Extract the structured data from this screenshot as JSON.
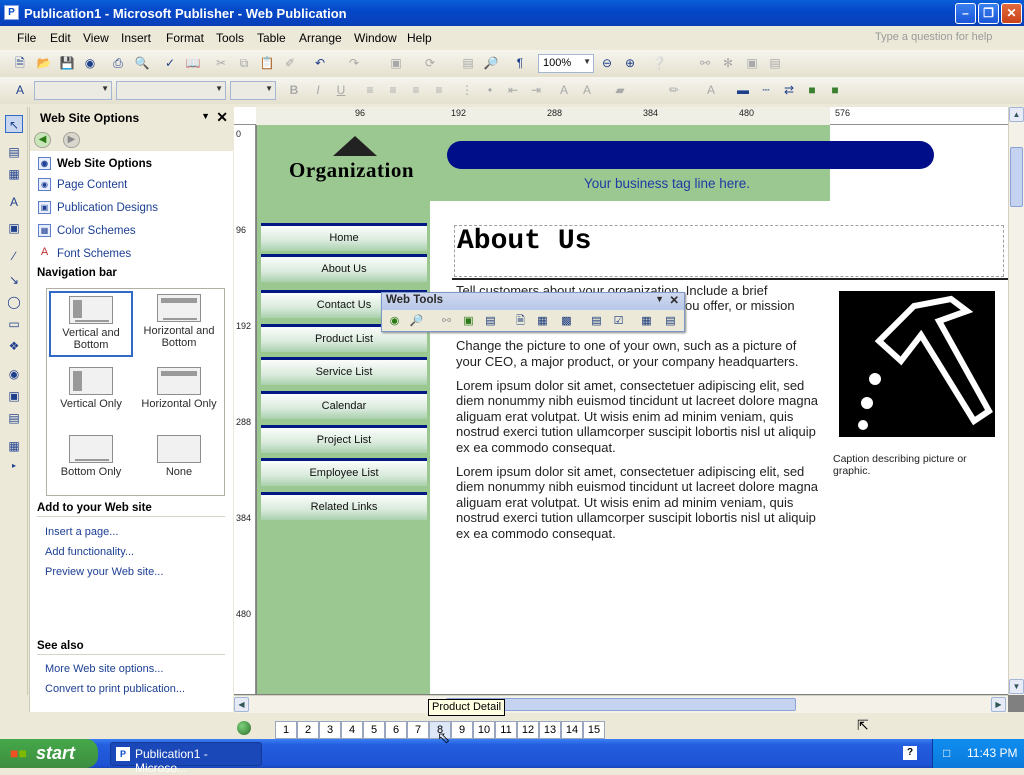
{
  "window": {
    "title": "Publication1 - Microsoft Publisher - Web Publication",
    "icon": "publisher-icon"
  },
  "menubar": {
    "items": [
      "File",
      "Edit",
      "View",
      "Insert",
      "Format",
      "Tools",
      "Table",
      "Arrange",
      "Window",
      "Help"
    ],
    "ask_placeholder": "Type a question for help"
  },
  "toolbar": {
    "zoom": "100%"
  },
  "taskpane": {
    "title": "Web Site Options",
    "items": [
      "Web Site Options",
      "Page Content",
      "Publication Designs",
      "Color Schemes",
      "Font Schemes"
    ],
    "navbar_heading": "Navigation bar",
    "nav_options": [
      "Vertical and Bottom",
      "Horizontal and Bottom",
      "Vertical Only",
      "Horizontal Only",
      "Bottom Only",
      "None"
    ],
    "add_heading": "Add to your Web site",
    "add_links": [
      "Insert a page...",
      "Add functionality...",
      "Preview your Web site..."
    ],
    "seealso_heading": "See also",
    "seealso_links": [
      "More Web site options...",
      "Convert to print publication..."
    ]
  },
  "rulers": {
    "h_marks": [
      "96",
      "192",
      "288",
      "384",
      "480",
      "576"
    ],
    "v_marks": [
      "0",
      "96",
      "192",
      "288",
      "384",
      "480"
    ]
  },
  "page": {
    "org_name": "Organization",
    "tagline": "Your business tag line here.",
    "nav_buttons": [
      "Home",
      "About Us",
      "Contact Us",
      "Product List",
      "Service List",
      "Calendar",
      "Project List",
      "Employee List",
      "Related Links"
    ],
    "heading": "About Us",
    "para1": "Tell customers about your organization. Include a brief description of the products or services you offer, or mission statement.",
    "para2": "Change the picture to one of your own, such as a picture of your CEO, a major product, or your company headquarters.",
    "para3": "Lorem ipsum dolor sit amet, consectetuer adipiscing elit, sed diem nonummy nibh euismod tincidunt ut lacreet dolore magna aliguam erat volutpat. Ut wisis enim ad minim veniam, quis nostrud exerci tution ullamcorper suscipit lobortis nisl ut aliquip ex ea commodo consequat.",
    "para4": "Lorem ipsum dolor sit amet, consectetuer adipiscing elit, sed diem nonummy nibh euismod tincidunt ut lacreet dolore magna aliguam erat volutpat. Ut wisis enim ad minim veniam, quis nostrud exerci tution ullamcorper suscipit lobortis nisl ut aliquip ex ea commodo consequat.",
    "caption": "Caption describing picture or graphic."
  },
  "webtools": {
    "title": "Web Tools"
  },
  "pages": {
    "numbers": [
      "1",
      "2",
      "3",
      "4",
      "5",
      "6",
      "7",
      "8",
      "9",
      "10",
      "11",
      "12",
      "13",
      "14",
      "15"
    ],
    "current": "8",
    "tooltip": "Product Detail"
  },
  "taskbar": {
    "start": "start",
    "app": "Publication1 - Microso...",
    "time": "11:43 PM"
  }
}
